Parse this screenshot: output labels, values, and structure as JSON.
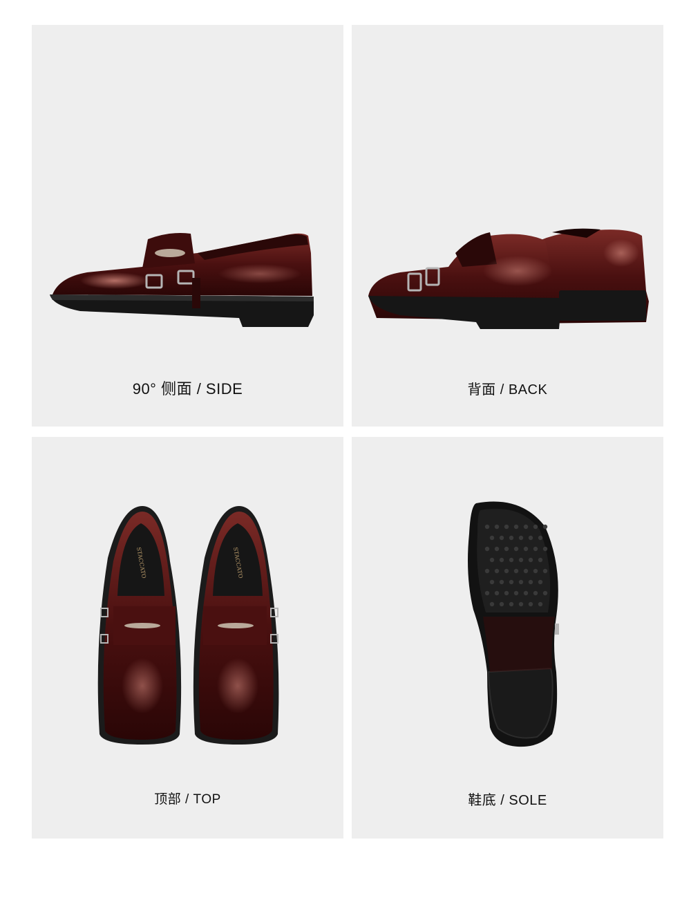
{
  "views": [
    {
      "id": "side",
      "caption": "90°  侧面  /  SIDE"
    },
    {
      "id": "back",
      "caption": "背面  /  BACK"
    },
    {
      "id": "top",
      "caption": "顶部  /  TOP"
    },
    {
      "id": "sole",
      "caption": "鞋底 / SOLE"
    }
  ],
  "brand_insole": "STACCATO",
  "colors": {
    "panel_bg": "#eeeeee",
    "leather": "#4a1010",
    "leather_highlight": "#8a3a36",
    "sole": "#1a1a1a",
    "buckle": "#a9a9a9"
  }
}
